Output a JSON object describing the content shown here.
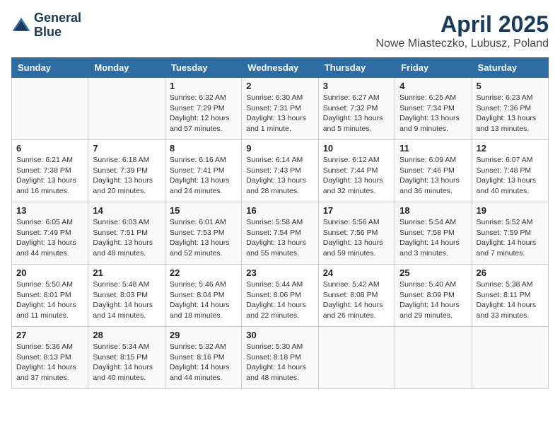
{
  "logo": {
    "line1": "General",
    "line2": "Blue"
  },
  "title": "April 2025",
  "subtitle": "Nowe Miasteczko, Lubusz, Poland",
  "days_of_week": [
    "Sunday",
    "Monday",
    "Tuesday",
    "Wednesday",
    "Thursday",
    "Friday",
    "Saturday"
  ],
  "weeks": [
    [
      {
        "day": "",
        "info": ""
      },
      {
        "day": "",
        "info": ""
      },
      {
        "day": "1",
        "info": "Sunrise: 6:32 AM\nSunset: 7:29 PM\nDaylight: 12 hours and 57 minutes."
      },
      {
        "day": "2",
        "info": "Sunrise: 6:30 AM\nSunset: 7:31 PM\nDaylight: 13 hours and 1 minute."
      },
      {
        "day": "3",
        "info": "Sunrise: 6:27 AM\nSunset: 7:32 PM\nDaylight: 13 hours and 5 minutes."
      },
      {
        "day": "4",
        "info": "Sunrise: 6:25 AM\nSunset: 7:34 PM\nDaylight: 13 hours and 9 minutes."
      },
      {
        "day": "5",
        "info": "Sunrise: 6:23 AM\nSunset: 7:36 PM\nDaylight: 13 hours and 13 minutes."
      }
    ],
    [
      {
        "day": "6",
        "info": "Sunrise: 6:21 AM\nSunset: 7:38 PM\nDaylight: 13 hours and 16 minutes."
      },
      {
        "day": "7",
        "info": "Sunrise: 6:18 AM\nSunset: 7:39 PM\nDaylight: 13 hours and 20 minutes."
      },
      {
        "day": "8",
        "info": "Sunrise: 6:16 AM\nSunset: 7:41 PM\nDaylight: 13 hours and 24 minutes."
      },
      {
        "day": "9",
        "info": "Sunrise: 6:14 AM\nSunset: 7:43 PM\nDaylight: 13 hours and 28 minutes."
      },
      {
        "day": "10",
        "info": "Sunrise: 6:12 AM\nSunset: 7:44 PM\nDaylight: 13 hours and 32 minutes."
      },
      {
        "day": "11",
        "info": "Sunrise: 6:09 AM\nSunset: 7:46 PM\nDaylight: 13 hours and 36 minutes."
      },
      {
        "day": "12",
        "info": "Sunrise: 6:07 AM\nSunset: 7:48 PM\nDaylight: 13 hours and 40 minutes."
      }
    ],
    [
      {
        "day": "13",
        "info": "Sunrise: 6:05 AM\nSunset: 7:49 PM\nDaylight: 13 hours and 44 minutes."
      },
      {
        "day": "14",
        "info": "Sunrise: 6:03 AM\nSunset: 7:51 PM\nDaylight: 13 hours and 48 minutes."
      },
      {
        "day": "15",
        "info": "Sunrise: 6:01 AM\nSunset: 7:53 PM\nDaylight: 13 hours and 52 minutes."
      },
      {
        "day": "16",
        "info": "Sunrise: 5:58 AM\nSunset: 7:54 PM\nDaylight: 13 hours and 55 minutes."
      },
      {
        "day": "17",
        "info": "Sunrise: 5:56 AM\nSunset: 7:56 PM\nDaylight: 13 hours and 59 minutes."
      },
      {
        "day": "18",
        "info": "Sunrise: 5:54 AM\nSunset: 7:58 PM\nDaylight: 14 hours and 3 minutes."
      },
      {
        "day": "19",
        "info": "Sunrise: 5:52 AM\nSunset: 7:59 PM\nDaylight: 14 hours and 7 minutes."
      }
    ],
    [
      {
        "day": "20",
        "info": "Sunrise: 5:50 AM\nSunset: 8:01 PM\nDaylight: 14 hours and 11 minutes."
      },
      {
        "day": "21",
        "info": "Sunrise: 5:48 AM\nSunset: 8:03 PM\nDaylight: 14 hours and 14 minutes."
      },
      {
        "day": "22",
        "info": "Sunrise: 5:46 AM\nSunset: 8:04 PM\nDaylight: 14 hours and 18 minutes."
      },
      {
        "day": "23",
        "info": "Sunrise: 5:44 AM\nSunset: 8:06 PM\nDaylight: 14 hours and 22 minutes."
      },
      {
        "day": "24",
        "info": "Sunrise: 5:42 AM\nSunset: 8:08 PM\nDaylight: 14 hours and 26 minutes."
      },
      {
        "day": "25",
        "info": "Sunrise: 5:40 AM\nSunset: 8:09 PM\nDaylight: 14 hours and 29 minutes."
      },
      {
        "day": "26",
        "info": "Sunrise: 5:38 AM\nSunset: 8:11 PM\nDaylight: 14 hours and 33 minutes."
      }
    ],
    [
      {
        "day": "27",
        "info": "Sunrise: 5:36 AM\nSunset: 8:13 PM\nDaylight: 14 hours and 37 minutes."
      },
      {
        "day": "28",
        "info": "Sunrise: 5:34 AM\nSunset: 8:15 PM\nDaylight: 14 hours and 40 minutes."
      },
      {
        "day": "29",
        "info": "Sunrise: 5:32 AM\nSunset: 8:16 PM\nDaylight: 14 hours and 44 minutes."
      },
      {
        "day": "30",
        "info": "Sunrise: 5:30 AM\nSunset: 8:18 PM\nDaylight: 14 hours and 48 minutes."
      },
      {
        "day": "",
        "info": ""
      },
      {
        "day": "",
        "info": ""
      },
      {
        "day": "",
        "info": ""
      }
    ]
  ]
}
